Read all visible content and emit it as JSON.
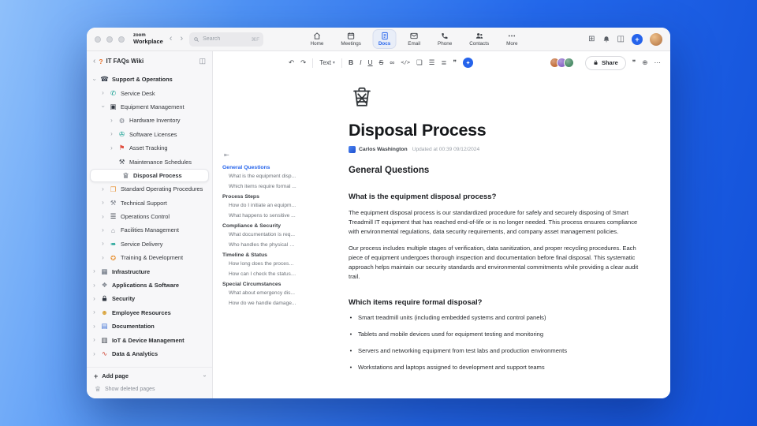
{
  "accent": "#2563eb",
  "icons": {
    "back": "‹",
    "forward": "›",
    "chevron": "›",
    "chevron_down": "›",
    "apps": "⊞",
    "panel": "◫",
    "wiki": "?",
    "toc_collapse": "⇤",
    "add": "+",
    "plus": "+"
  },
  "titlebar": {
    "logo": {
      "zoom": "zoom",
      "workplace": "Workplace"
    },
    "search": {
      "placeholder": "Search",
      "shortcut": "⌘F"
    },
    "nav": [
      {
        "label": "Home",
        "icon": "home-icon",
        "glyph": "svg:i-home",
        "active": false
      },
      {
        "label": "Meetings",
        "icon": "meetings-calendar-icon",
        "glyph": "svg:i-cal",
        "active": false
      },
      {
        "label": "Docs",
        "icon": "docs-icon",
        "glyph": "svg:i-doc",
        "active": true
      },
      {
        "label": "Email",
        "icon": "email-icon",
        "glyph": "svg:i-mail",
        "active": false
      },
      {
        "label": "Phone",
        "icon": "phone-icon",
        "glyph": "svg:i-phone",
        "active": false
      },
      {
        "label": "Contacts",
        "icon": "contacts-icon",
        "glyph": "svg:i-people",
        "active": false
      },
      {
        "label": "More",
        "icon": "more-icon",
        "glyph": "svg:i-more",
        "active": false
      }
    ]
  },
  "sidebar": {
    "title": "IT FAQs Wiki",
    "add_page": "Add page",
    "show_deleted": "Show deleted pages",
    "tree": [
      {
        "label": "Support & Operations",
        "depth": 0,
        "icon": "phone-icon",
        "glyph": "☎",
        "color": "#3b4350",
        "chevron": "down",
        "selected": false
      },
      {
        "label": "Service Desk",
        "depth": 1,
        "icon": "headset-icon",
        "glyph": "✆",
        "color": "#0f9d8f",
        "chevron": "right",
        "selected": false
      },
      {
        "label": "Equipment Management",
        "depth": 1,
        "icon": "monitor-icon",
        "glyph": "▣",
        "color": "#2f3640",
        "chevron": "down",
        "selected": false
      },
      {
        "label": "Hardware Inventory",
        "depth": 2,
        "icon": "gear-icon",
        "glyph": "⚙",
        "color": "#7d838d",
        "chevron": "right",
        "selected": false
      },
      {
        "label": "Software Licenses",
        "depth": 2,
        "icon": "disc-icon",
        "glyph": "✇",
        "color": "#0f9d8f",
        "chevron": "right",
        "selected": false
      },
      {
        "label": "Asset Tracking",
        "depth": 2,
        "icon": "pin-flag-icon",
        "glyph": "⚑",
        "color": "#e04f3f",
        "chevron": "right",
        "selected": false
      },
      {
        "label": "Maintenance Schedules",
        "depth": 2,
        "icon": "tools-icon",
        "glyph": "⚒",
        "color": "#4a5058",
        "chevron": "none",
        "selected": false
      },
      {
        "label": "Disposal Process",
        "depth": 2,
        "icon": "trash-icon",
        "glyph": "svg:i-trash",
        "color": "#5f6670",
        "chevron": "none",
        "selected": true
      },
      {
        "label": "Standard Operating Procedures",
        "depth": 1,
        "icon": "procedures-icon",
        "glyph": "❐",
        "color": "#e8963c",
        "chevron": "right",
        "selected": false
      },
      {
        "label": "Technical Support",
        "depth": 1,
        "icon": "wrench-icon",
        "glyph": "⚒",
        "color": "#7d838d",
        "chevron": "right",
        "selected": false
      },
      {
        "label": "Operations Control",
        "depth": 1,
        "icon": "sliders-icon",
        "glyph": "☰",
        "color": "#2f3640",
        "chevron": "right",
        "selected": false
      },
      {
        "label": "Facilities Management",
        "depth": 1,
        "icon": "building-icon",
        "glyph": "⌂",
        "color": "#7d838d",
        "chevron": "right",
        "selected": false
      },
      {
        "label": "Service Delivery",
        "depth": 1,
        "icon": "delivery-icon",
        "glyph": "➠",
        "color": "#0f9d8f",
        "chevron": "right",
        "selected": false
      },
      {
        "label": "Training & Development",
        "depth": 1,
        "icon": "training-icon",
        "glyph": "✪",
        "color": "#e8963c",
        "chevron": "right",
        "selected": false
      },
      {
        "label": "Infrastructure",
        "depth": 0,
        "icon": "server-icon",
        "glyph": "▦",
        "color": "#5a6472",
        "chevron": "right",
        "selected": false
      },
      {
        "label": "Applications & Software",
        "depth": 0,
        "icon": "apps-icon",
        "glyph": "❖",
        "color": "#7d838d",
        "chevron": "right",
        "selected": false
      },
      {
        "label": "Security",
        "depth": 0,
        "icon": "lock-icon",
        "glyph": "svg:i-lock",
        "color": "#2f3640",
        "chevron": "right",
        "selected": false
      },
      {
        "label": "Employee Resources",
        "depth": 0,
        "icon": "people-icon",
        "glyph": "☻",
        "color": "#d9a33a",
        "chevron": "right",
        "selected": false
      },
      {
        "label": "Documentation",
        "depth": 0,
        "icon": "document-icon",
        "glyph": "▤",
        "color": "#3b6fd4",
        "chevron": "right",
        "selected": false
      },
      {
        "label": "IoT & Device Management",
        "depth": 0,
        "icon": "device-icon",
        "glyph": "▥",
        "color": "#2f3640",
        "chevron": "right",
        "selected": false
      },
      {
        "label": "Data & Analytics",
        "depth": 0,
        "icon": "analytics-icon",
        "glyph": "∿",
        "color": "#d04c3c",
        "chevron": "right",
        "selected": false
      }
    ]
  },
  "toolbar": {
    "undo": "↶",
    "redo": "↷",
    "text_style": "Text",
    "dropdown": "▾",
    "bold": "B",
    "italic": "I",
    "underline": "U",
    "strike": "S",
    "link": "∞",
    "code": "</>",
    "blocks": "❏",
    "list": "☰",
    "align": "≣",
    "comment": "❞",
    "ai": "✦",
    "globe": "⊕",
    "more": "⋯",
    "share_label": "Share",
    "avatar_colors": [
      "#c4713f",
      "#8d6bc8",
      "#4f8f6b"
    ]
  },
  "doc": {
    "title": "Disposal Process",
    "author": "Carlos Washington",
    "updated": "Updated at 00:39 09/12/2024",
    "toc": [
      {
        "type": "section",
        "label": "General Questions",
        "active": true
      },
      {
        "type": "item",
        "label": "What is the equipment disp...",
        "active": false
      },
      {
        "type": "item",
        "label": "Which items require formal ...",
        "active": false
      },
      {
        "type": "section",
        "label": "Process Steps",
        "active": false
      },
      {
        "type": "item",
        "label": "How do I initiate an equipm...",
        "active": false
      },
      {
        "type": "item",
        "label": "What happens to sensitive ...",
        "active": false
      },
      {
        "type": "section",
        "label": "Compliance & Security",
        "active": false
      },
      {
        "type": "item",
        "label": "What documentation is req...",
        "active": false
      },
      {
        "type": "item",
        "label": "Who handles the physical di...",
        "active": false
      },
      {
        "type": "section",
        "label": "Timeline & Status",
        "active": false
      },
      {
        "type": "item",
        "label": "How long does the process ...",
        "active": false
      },
      {
        "type": "item",
        "label": "How can I check the status ...",
        "active": false
      },
      {
        "type": "section",
        "label": "Special Circumstances",
        "active": false
      },
      {
        "type": "item",
        "label": "What about emergency dis...",
        "active": false
      },
      {
        "type": "item",
        "label": "How do we handle damage...",
        "active": false
      }
    ],
    "body": [
      {
        "type": "h2",
        "text": "General Questions"
      },
      {
        "type": "h3",
        "text": "What is the equipment disposal process?"
      },
      {
        "type": "p",
        "text": "The equipment disposal process is our standardized procedure for safely and securely disposing of Smart Treadmill IT equipment that has reached end-of-life or is no longer needed. This process ensures compliance with environmental regulations, data security requirements, and company asset management policies."
      },
      {
        "type": "p",
        "text": "Our process includes multiple stages of verification, data sanitization, and proper recycling procedures. Each piece of equipment undergoes thorough inspection and documentation before final disposal. This systematic approach helps maintain our security standards and environmental commitments while providing a clear audit trail."
      },
      {
        "type": "h3",
        "text": "Which items require formal disposal?"
      },
      {
        "type": "li",
        "text": "Smart treadmill units (including embedded systems and control panels)"
      },
      {
        "type": "li",
        "text": "Tablets and mobile devices used for equipment testing and monitoring"
      },
      {
        "type": "li",
        "text": "Servers and networking equipment from test labs and production environments"
      },
      {
        "type": "li",
        "text": "Workstations and laptops assigned to development and support teams"
      }
    ]
  }
}
